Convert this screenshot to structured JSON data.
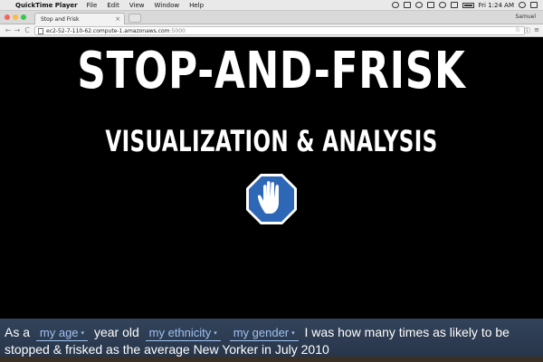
{
  "menubar": {
    "app_name": "QuickTime Player",
    "menus": [
      "File",
      "Edit",
      "View",
      "Window",
      "Help"
    ],
    "clock": "Fri 1:24 AM"
  },
  "browser": {
    "tab_title": "Stop and Frisk",
    "profile_name": "Samuel",
    "url_host": "ec2-52-7-110-62.compute-1.amazonaws.com",
    "url_port": ":5000"
  },
  "page": {
    "title": "STOP-AND-FRISK",
    "subtitle": "VISUALIZATION & ANALYSIS",
    "logo_icon": "stop-hand-icon",
    "sentence": {
      "part1": "As a",
      "age_dropdown": "my age",
      "part2": "year old",
      "ethnicity_dropdown": "my ethnicity",
      "gender_dropdown": "my gender",
      "part3": "I was how many times as likely to be stopped & frisked as the average New Yorker in July 2010"
    }
  },
  "colors": {
    "sign_blue": "#2e67b5",
    "dropdown_text": "#9fc1f0",
    "bar_bg": "#2d3c52"
  }
}
